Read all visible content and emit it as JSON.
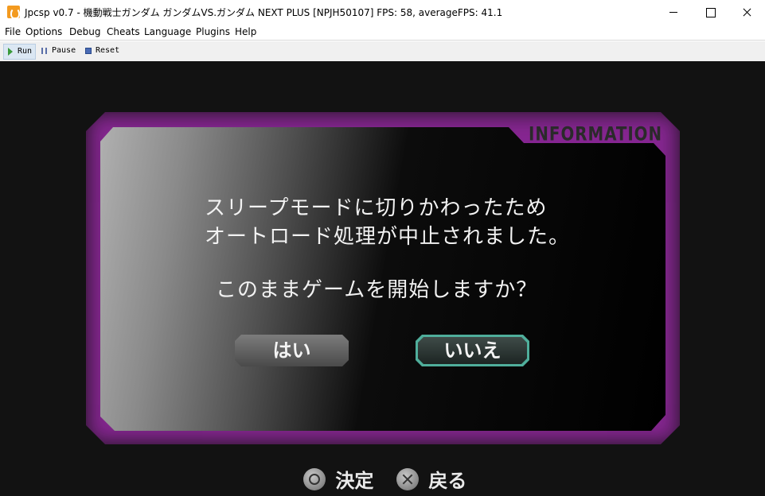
{
  "window": {
    "title": "Jpcsp v0.7 - 機動戦士ガンダム ガンダムVS.ガンダム NEXT PLUS [NPJH50107] FPS: 58, averageFPS: 41.1"
  },
  "menu": {
    "items": [
      "File",
      "Options",
      "Debug",
      "Cheats",
      "Language",
      "Plugins",
      "Help"
    ]
  },
  "toolbar": {
    "run": "Run",
    "pause": "Pause",
    "reset": "Reset"
  },
  "game": {
    "panel_label": "INFORMATION",
    "message_line1": "スリープモードに切りかわったため",
    "message_line2": "オートロード処理が中止されました。",
    "question": "このままゲームを開始しますか？",
    "yes": "はい",
    "no": "いいえ",
    "selected": "いいえ",
    "hint_confirm": "決定",
    "hint_back": "戻る"
  },
  "colors": {
    "glow": "#9b2aa8",
    "selection": "#4fae9b",
    "app_icon": "#f39a1f"
  }
}
